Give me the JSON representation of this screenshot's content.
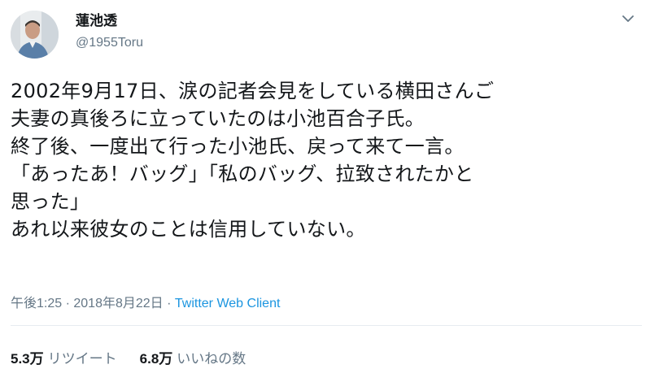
{
  "user": {
    "display_name": "蓮池透",
    "handle": "@1955Toru"
  },
  "tweet": {
    "lines": [
      "2002年9月17日、涙の記者会見をしている横田さんご",
      "夫妻の真後ろに立っていたのは小池百合子氏。",
      "終了後、一度出て行った小池氏、戻って来て一言。",
      "「あったあ！バッグ」「私のバッグ、拉致されたかと",
      "思った」",
      "あれ以来彼女のことは信用していない。"
    ],
    "time": "午後1:25",
    "separator": " · ",
    "date": "2018年8月22日",
    "source": "Twitter Web Client"
  },
  "stats": {
    "retweets_count": "5.3万",
    "retweets_label": "リツイート",
    "likes_count": "6.8万",
    "likes_label": "いいねの数"
  },
  "icons": {
    "menu": "chevron-down-icon",
    "avatar": "profile-photo"
  },
  "colors": {
    "text": "#14171a",
    "secondary": "#657786",
    "link": "#1b95e0",
    "divider": "#e6ecf0"
  }
}
